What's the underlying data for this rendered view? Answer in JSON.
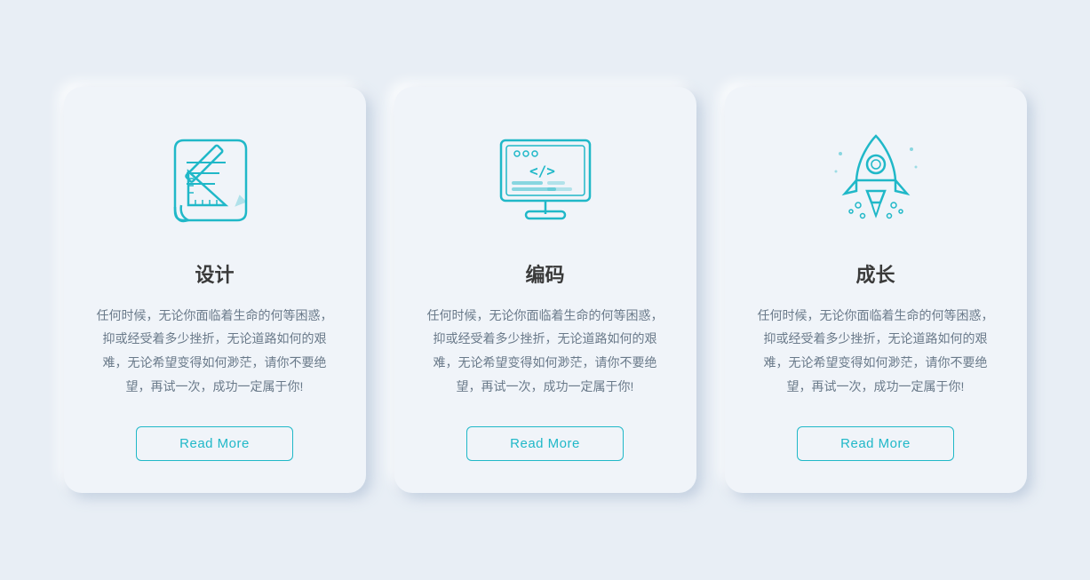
{
  "cards": [
    {
      "id": "design",
      "icon": "design-icon",
      "title": "设计",
      "description": "任何时候，无论你面临着生命的何等困惑，抑或经受着多少挫折，无论道路如何的艰难，无论希望变得如何渺茫，请你不要绝望，再试一次，成功一定属于你!",
      "button_label": "Read More"
    },
    {
      "id": "coding",
      "icon": "coding-icon",
      "title": "编码",
      "description": "任何时候，无论你面临着生命的何等困惑，抑或经受着多少挫折，无论道路如何的艰难，无论希望变得如何渺茫，请你不要绝望，再试一次，成功一定属于你!",
      "button_label": "Read More"
    },
    {
      "id": "growth",
      "icon": "rocket-icon",
      "title": "成长",
      "description": "任何时候，无论你面临着生命的何等困惑，抑或经受着多少挫折，无论道路如何的艰难，无论希望变得如何渺茫，请你不要绝望，再试一次，成功一定属于你!",
      "button_label": "Read More"
    }
  ],
  "colors": {
    "accent": "#20b8c8",
    "text_primary": "#3a3a3a",
    "text_secondary": "#6a7a8a",
    "background": "#e8eef5",
    "card_bg": "#f0f4f9"
  }
}
